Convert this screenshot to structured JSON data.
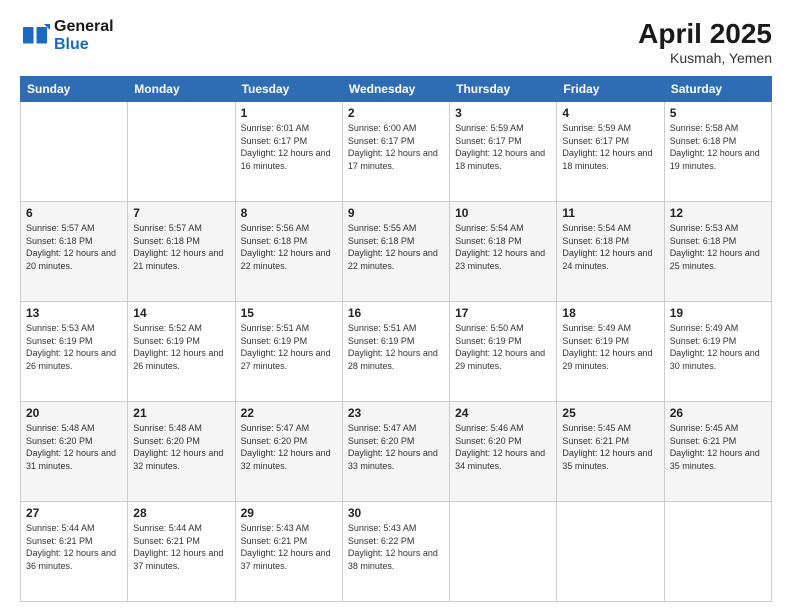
{
  "header": {
    "logo_general": "General",
    "logo_blue": "Blue",
    "month_year": "April 2025",
    "location": "Kusmah, Yemen"
  },
  "days_of_week": [
    "Sunday",
    "Monday",
    "Tuesday",
    "Wednesday",
    "Thursday",
    "Friday",
    "Saturday"
  ],
  "weeks": [
    [
      {
        "day": "",
        "info": ""
      },
      {
        "day": "",
        "info": ""
      },
      {
        "day": "1",
        "info": "Sunrise: 6:01 AM\nSunset: 6:17 PM\nDaylight: 12 hours and 16 minutes."
      },
      {
        "day": "2",
        "info": "Sunrise: 6:00 AM\nSunset: 6:17 PM\nDaylight: 12 hours and 17 minutes."
      },
      {
        "day": "3",
        "info": "Sunrise: 5:59 AM\nSunset: 6:17 PM\nDaylight: 12 hours and 18 minutes."
      },
      {
        "day": "4",
        "info": "Sunrise: 5:59 AM\nSunset: 6:17 PM\nDaylight: 12 hours and 18 minutes."
      },
      {
        "day": "5",
        "info": "Sunrise: 5:58 AM\nSunset: 6:18 PM\nDaylight: 12 hours and 19 minutes."
      }
    ],
    [
      {
        "day": "6",
        "info": "Sunrise: 5:57 AM\nSunset: 6:18 PM\nDaylight: 12 hours and 20 minutes."
      },
      {
        "day": "7",
        "info": "Sunrise: 5:57 AM\nSunset: 6:18 PM\nDaylight: 12 hours and 21 minutes."
      },
      {
        "day": "8",
        "info": "Sunrise: 5:56 AM\nSunset: 6:18 PM\nDaylight: 12 hours and 22 minutes."
      },
      {
        "day": "9",
        "info": "Sunrise: 5:55 AM\nSunset: 6:18 PM\nDaylight: 12 hours and 22 minutes."
      },
      {
        "day": "10",
        "info": "Sunrise: 5:54 AM\nSunset: 6:18 PM\nDaylight: 12 hours and 23 minutes."
      },
      {
        "day": "11",
        "info": "Sunrise: 5:54 AM\nSunset: 6:18 PM\nDaylight: 12 hours and 24 minutes."
      },
      {
        "day": "12",
        "info": "Sunrise: 5:53 AM\nSunset: 6:18 PM\nDaylight: 12 hours and 25 minutes."
      }
    ],
    [
      {
        "day": "13",
        "info": "Sunrise: 5:53 AM\nSunset: 6:19 PM\nDaylight: 12 hours and 26 minutes."
      },
      {
        "day": "14",
        "info": "Sunrise: 5:52 AM\nSunset: 6:19 PM\nDaylight: 12 hours and 26 minutes."
      },
      {
        "day": "15",
        "info": "Sunrise: 5:51 AM\nSunset: 6:19 PM\nDaylight: 12 hours and 27 minutes."
      },
      {
        "day": "16",
        "info": "Sunrise: 5:51 AM\nSunset: 6:19 PM\nDaylight: 12 hours and 28 minutes."
      },
      {
        "day": "17",
        "info": "Sunrise: 5:50 AM\nSunset: 6:19 PM\nDaylight: 12 hours and 29 minutes."
      },
      {
        "day": "18",
        "info": "Sunrise: 5:49 AM\nSunset: 6:19 PM\nDaylight: 12 hours and 29 minutes."
      },
      {
        "day": "19",
        "info": "Sunrise: 5:49 AM\nSunset: 6:19 PM\nDaylight: 12 hours and 30 minutes."
      }
    ],
    [
      {
        "day": "20",
        "info": "Sunrise: 5:48 AM\nSunset: 6:20 PM\nDaylight: 12 hours and 31 minutes."
      },
      {
        "day": "21",
        "info": "Sunrise: 5:48 AM\nSunset: 6:20 PM\nDaylight: 12 hours and 32 minutes."
      },
      {
        "day": "22",
        "info": "Sunrise: 5:47 AM\nSunset: 6:20 PM\nDaylight: 12 hours and 32 minutes."
      },
      {
        "day": "23",
        "info": "Sunrise: 5:47 AM\nSunset: 6:20 PM\nDaylight: 12 hours and 33 minutes."
      },
      {
        "day": "24",
        "info": "Sunrise: 5:46 AM\nSunset: 6:20 PM\nDaylight: 12 hours and 34 minutes."
      },
      {
        "day": "25",
        "info": "Sunrise: 5:45 AM\nSunset: 6:21 PM\nDaylight: 12 hours and 35 minutes."
      },
      {
        "day": "26",
        "info": "Sunrise: 5:45 AM\nSunset: 6:21 PM\nDaylight: 12 hours and 35 minutes."
      }
    ],
    [
      {
        "day": "27",
        "info": "Sunrise: 5:44 AM\nSunset: 6:21 PM\nDaylight: 12 hours and 36 minutes."
      },
      {
        "day": "28",
        "info": "Sunrise: 5:44 AM\nSunset: 6:21 PM\nDaylight: 12 hours and 37 minutes."
      },
      {
        "day": "29",
        "info": "Sunrise: 5:43 AM\nSunset: 6:21 PM\nDaylight: 12 hours and 37 minutes."
      },
      {
        "day": "30",
        "info": "Sunrise: 5:43 AM\nSunset: 6:22 PM\nDaylight: 12 hours and 38 minutes."
      },
      {
        "day": "",
        "info": ""
      },
      {
        "day": "",
        "info": ""
      },
      {
        "day": "",
        "info": ""
      }
    ]
  ]
}
